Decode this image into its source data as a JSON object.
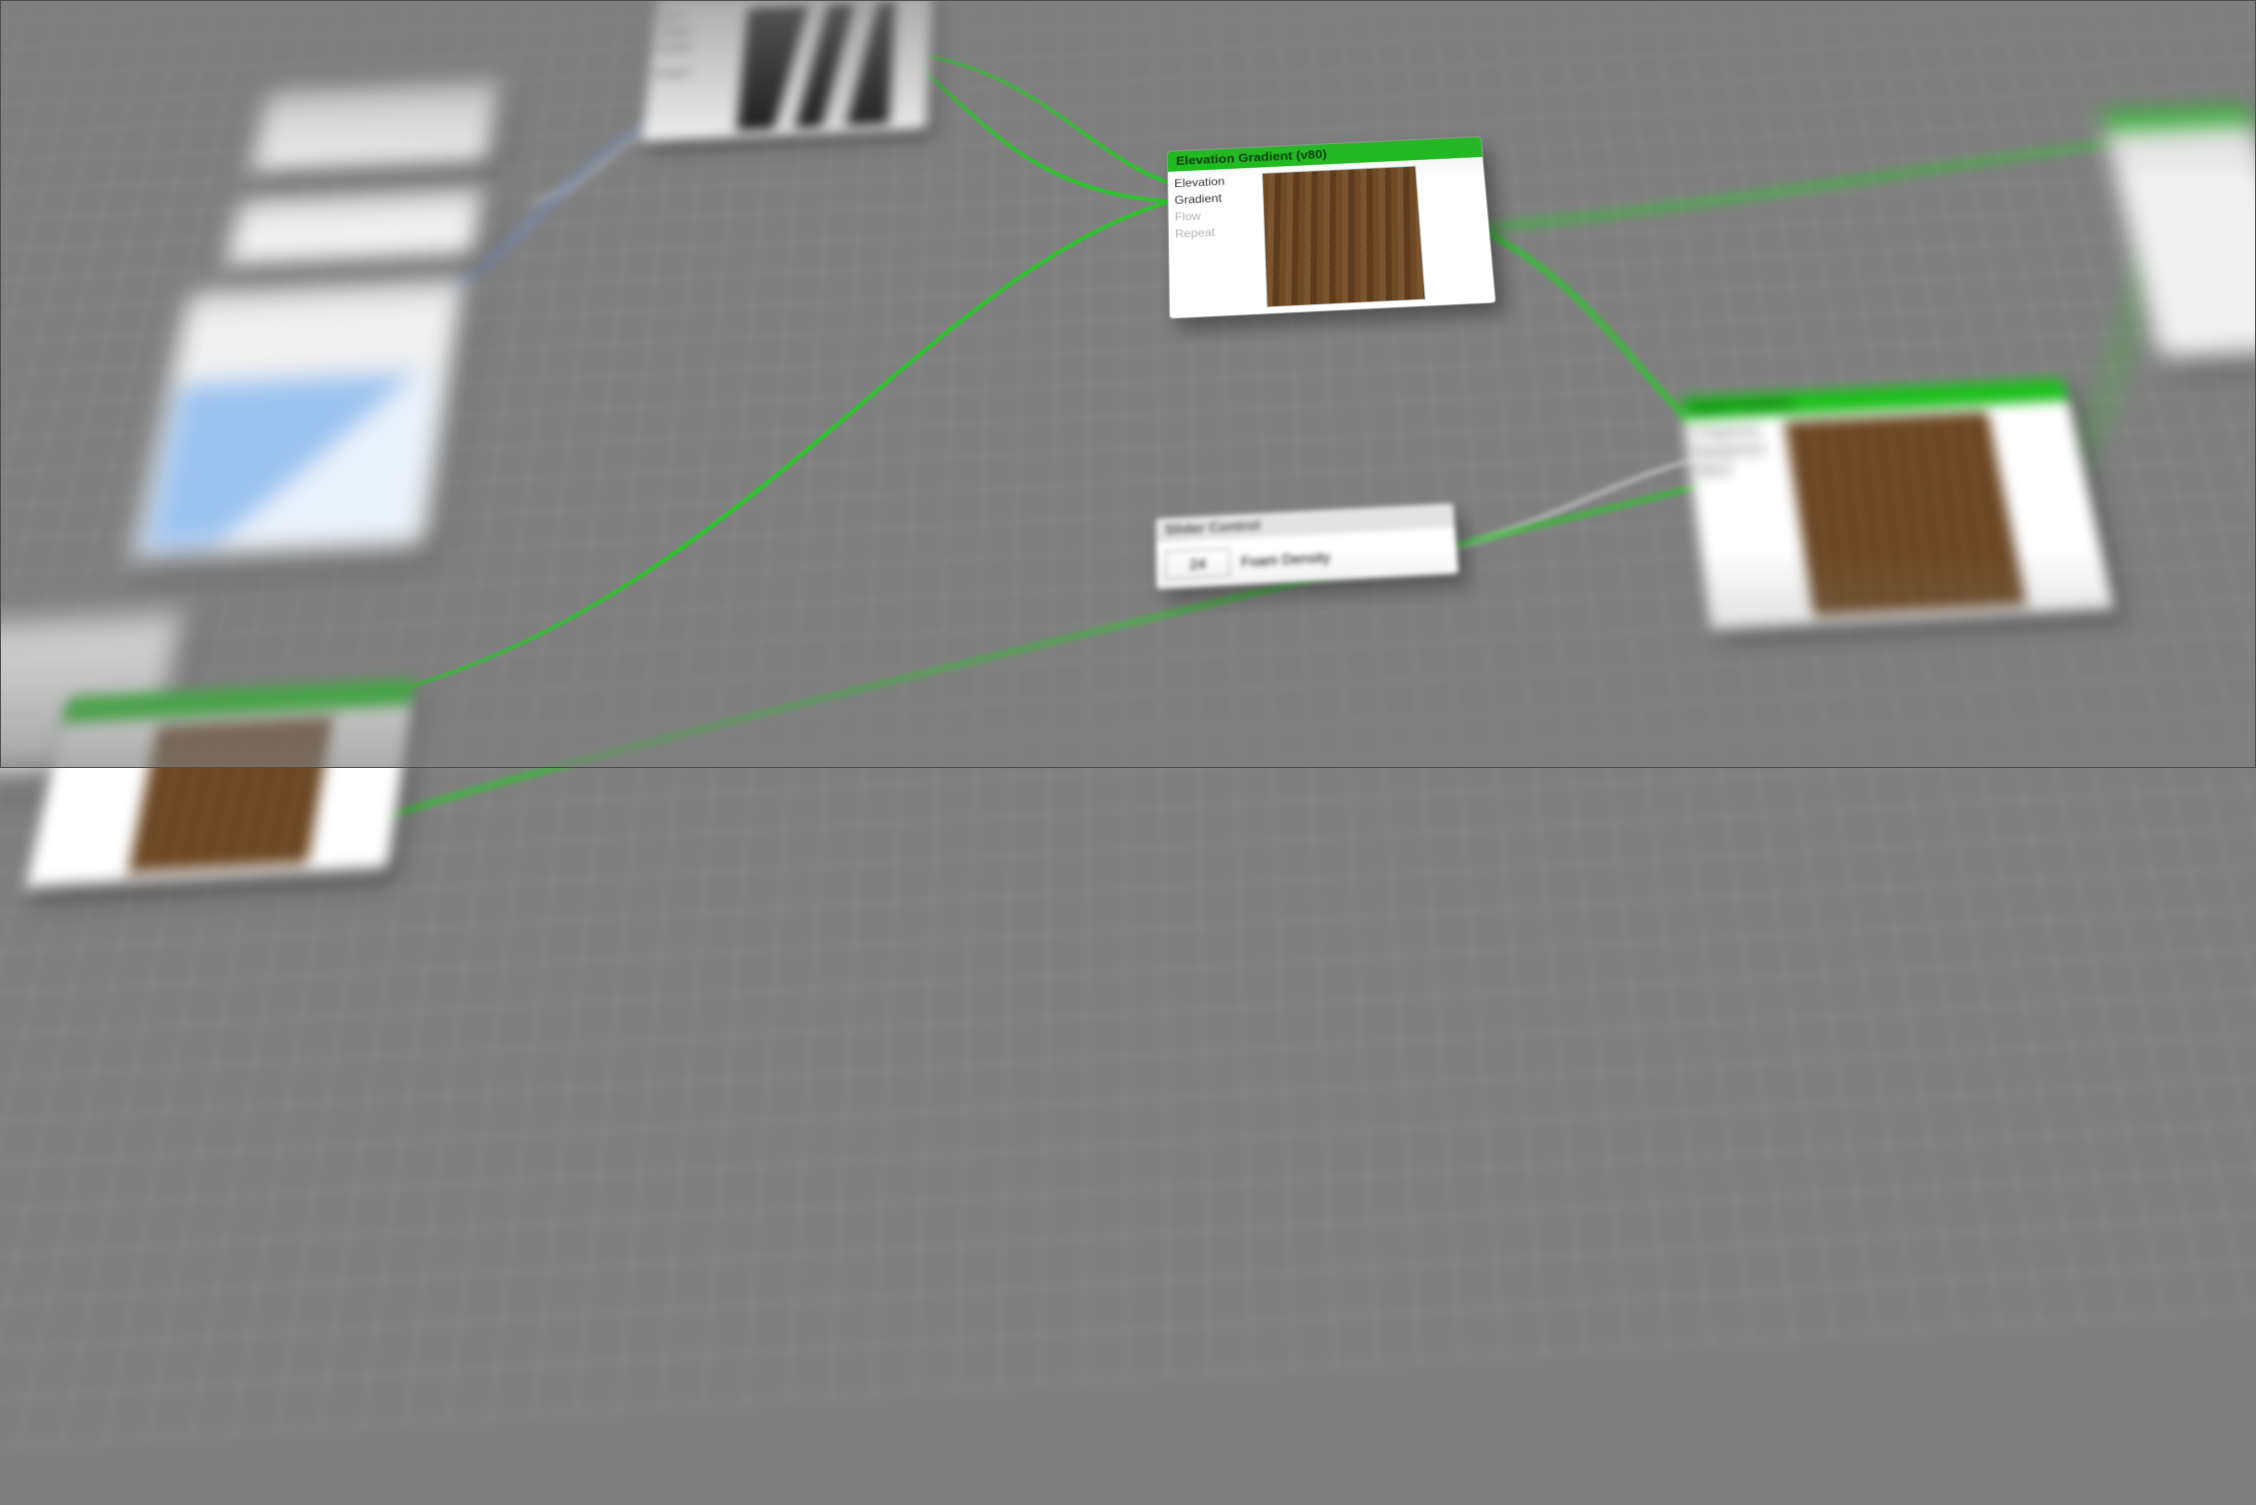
{
  "colors": {
    "brand_green": "#1bbf1b",
    "wire_green": "#29c629",
    "wire_blue": "#6b8ccf",
    "wire_grey": "#bfbfbf"
  },
  "nodes": {
    "elevation": {
      "title": "Elevation Gradient (v80)",
      "ports": {
        "elevation": "Elevation",
        "gradient": "Gradient",
        "flow": "Flow",
        "repeat": "Repeat"
      }
    },
    "slider": {
      "title": "Slider Control",
      "value": "24",
      "label": "Foam Density"
    },
    "detail": {
      "title": "Detail Combine",
      "ports": {
        "foreground": "Foreground",
        "background": "Background",
        "blend": "Blend"
      }
    },
    "strata": {
      "ports": {
        "sort": "Sort",
        "select": "Select",
        "graph": "Graph",
        "scalar": "Scalar"
      }
    }
  }
}
